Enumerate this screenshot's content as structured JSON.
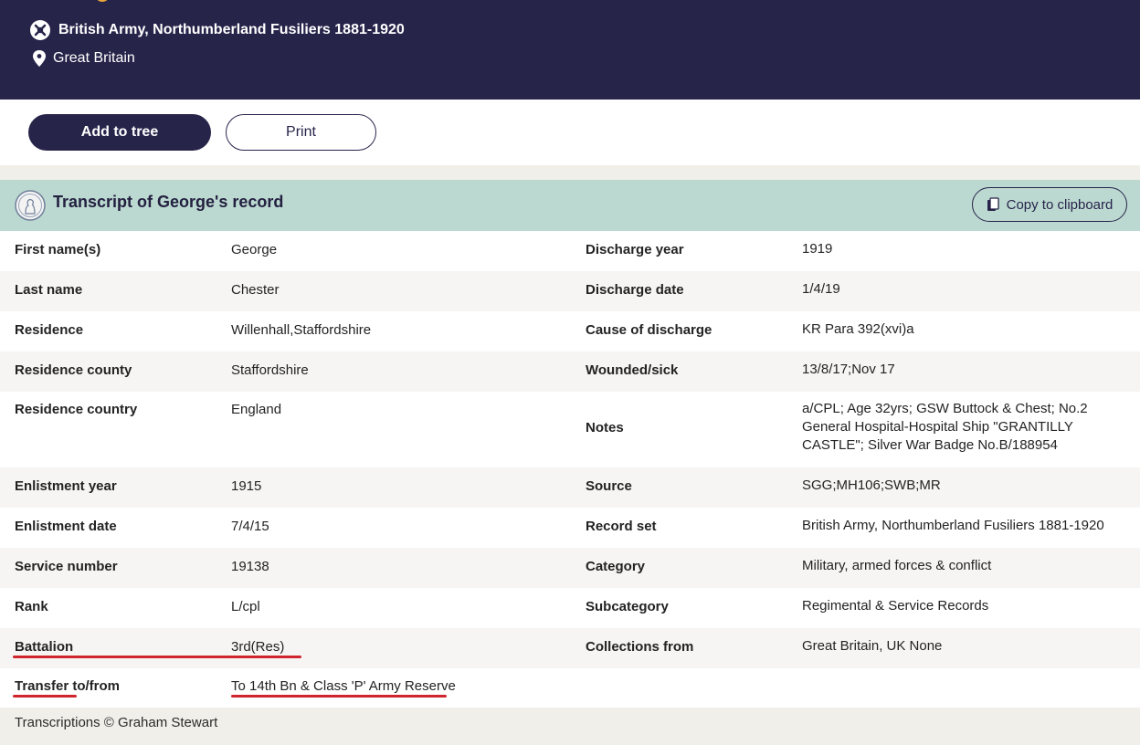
{
  "header": {
    "collection": "British Army, Northumberland Fusiliers 1881-1920",
    "location": "Great Britain",
    "icons": {
      "collection": "collection-icon",
      "location": "location-pin-icon"
    }
  },
  "actions": {
    "add_to_tree": "Add to tree",
    "print": "Print"
  },
  "transcript": {
    "title": "Transcript of George's record",
    "copy_label": "Copy to clipboard",
    "rows": [
      {
        "l1": "First name(s)",
        "v1": "George",
        "l2": "Discharge year",
        "v2": "1919"
      },
      {
        "l1": "Last name",
        "v1": "Chester",
        "l2": "Discharge date",
        "v2": "1/4/19"
      },
      {
        "l1": "Residence",
        "v1": "Willenhall,Staffordshire",
        "l2": "Cause of discharge",
        "v2": "KR Para 392(xvi)a"
      },
      {
        "l1": "Residence county",
        "v1": "Staffordshire",
        "l2": "Wounded/sick",
        "v2": "13/8/17;Nov 17"
      },
      {
        "l1": "Residence country",
        "v1": "England",
        "l2": "Notes",
        "v2": "a/CPL; Age 32yrs; GSW Buttock & Chest; No.2 General Hospital-Hospital Ship \"GRANTILLY CASTLE\"; Silver War Badge No.B/188954"
      },
      {
        "l1": "Enlistment year",
        "v1": "1915",
        "l2": "Source",
        "v2": "SGG;MH106;SWB;MR"
      },
      {
        "l1": "Enlistment date",
        "v1": "7/4/15",
        "l2": "Record set",
        "v2": "British Army, Northumberland Fusiliers 1881-1920"
      },
      {
        "l1": "Service number",
        "v1": "19138",
        "l2": "Category",
        "v2": "Military, armed forces & conflict"
      },
      {
        "l1": "Rank",
        "v1": "L/cpl",
        "l2": "Subcategory",
        "v2": "Regimental & Service Records"
      },
      {
        "l1": "Battalion",
        "v1": "3rd(Res)",
        "l2": "Collections from",
        "v2": "Great Britain, UK None"
      },
      {
        "l1": "Transfer to/from",
        "v1": "To 14th Bn & Class 'P' Army Reserve",
        "l2": "",
        "v2": ""
      }
    ]
  },
  "footer": {
    "credit": "Transcriptions © Graham Stewart"
  },
  "colors": {
    "header_bg": "#27244a",
    "panel_head_bg": "#bcd9d1",
    "underline": "#d0252f",
    "page_bg": "#f1efea"
  }
}
